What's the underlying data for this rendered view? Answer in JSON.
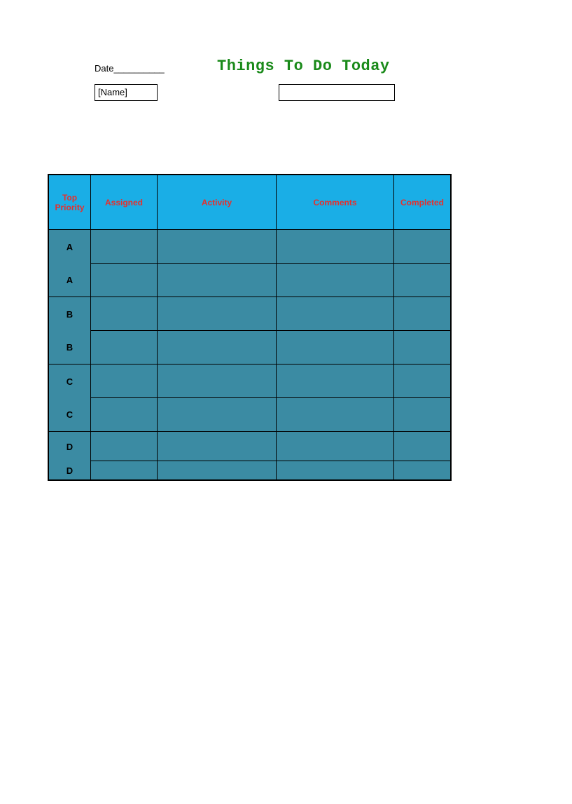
{
  "header": {
    "date_label": "Date__________",
    "title": "Things To Do Today",
    "name_placeholder": "[Name]"
  },
  "table": {
    "columns": [
      "Top Priority",
      "Assigned",
      "Activity",
      "Comments",
      "Completed"
    ],
    "rows": [
      {
        "priority": "A",
        "assigned": "",
        "activity": "",
        "comments": "",
        "completed": ""
      },
      {
        "priority": "A",
        "assigned": "",
        "activity": "",
        "comments": "",
        "completed": ""
      },
      {
        "priority": "B",
        "assigned": "",
        "activity": "",
        "comments": "",
        "completed": ""
      },
      {
        "priority": "B",
        "assigned": "",
        "activity": "",
        "comments": "",
        "completed": ""
      },
      {
        "priority": "C",
        "assigned": "",
        "activity": "",
        "comments": "",
        "completed": ""
      },
      {
        "priority": "C",
        "assigned": "",
        "activity": "",
        "comments": "",
        "completed": ""
      },
      {
        "priority": "D",
        "assigned": "",
        "activity": "",
        "comments": "",
        "completed": ""
      },
      {
        "priority": "D",
        "assigned": "",
        "activity": "",
        "comments": "",
        "completed": ""
      }
    ]
  }
}
